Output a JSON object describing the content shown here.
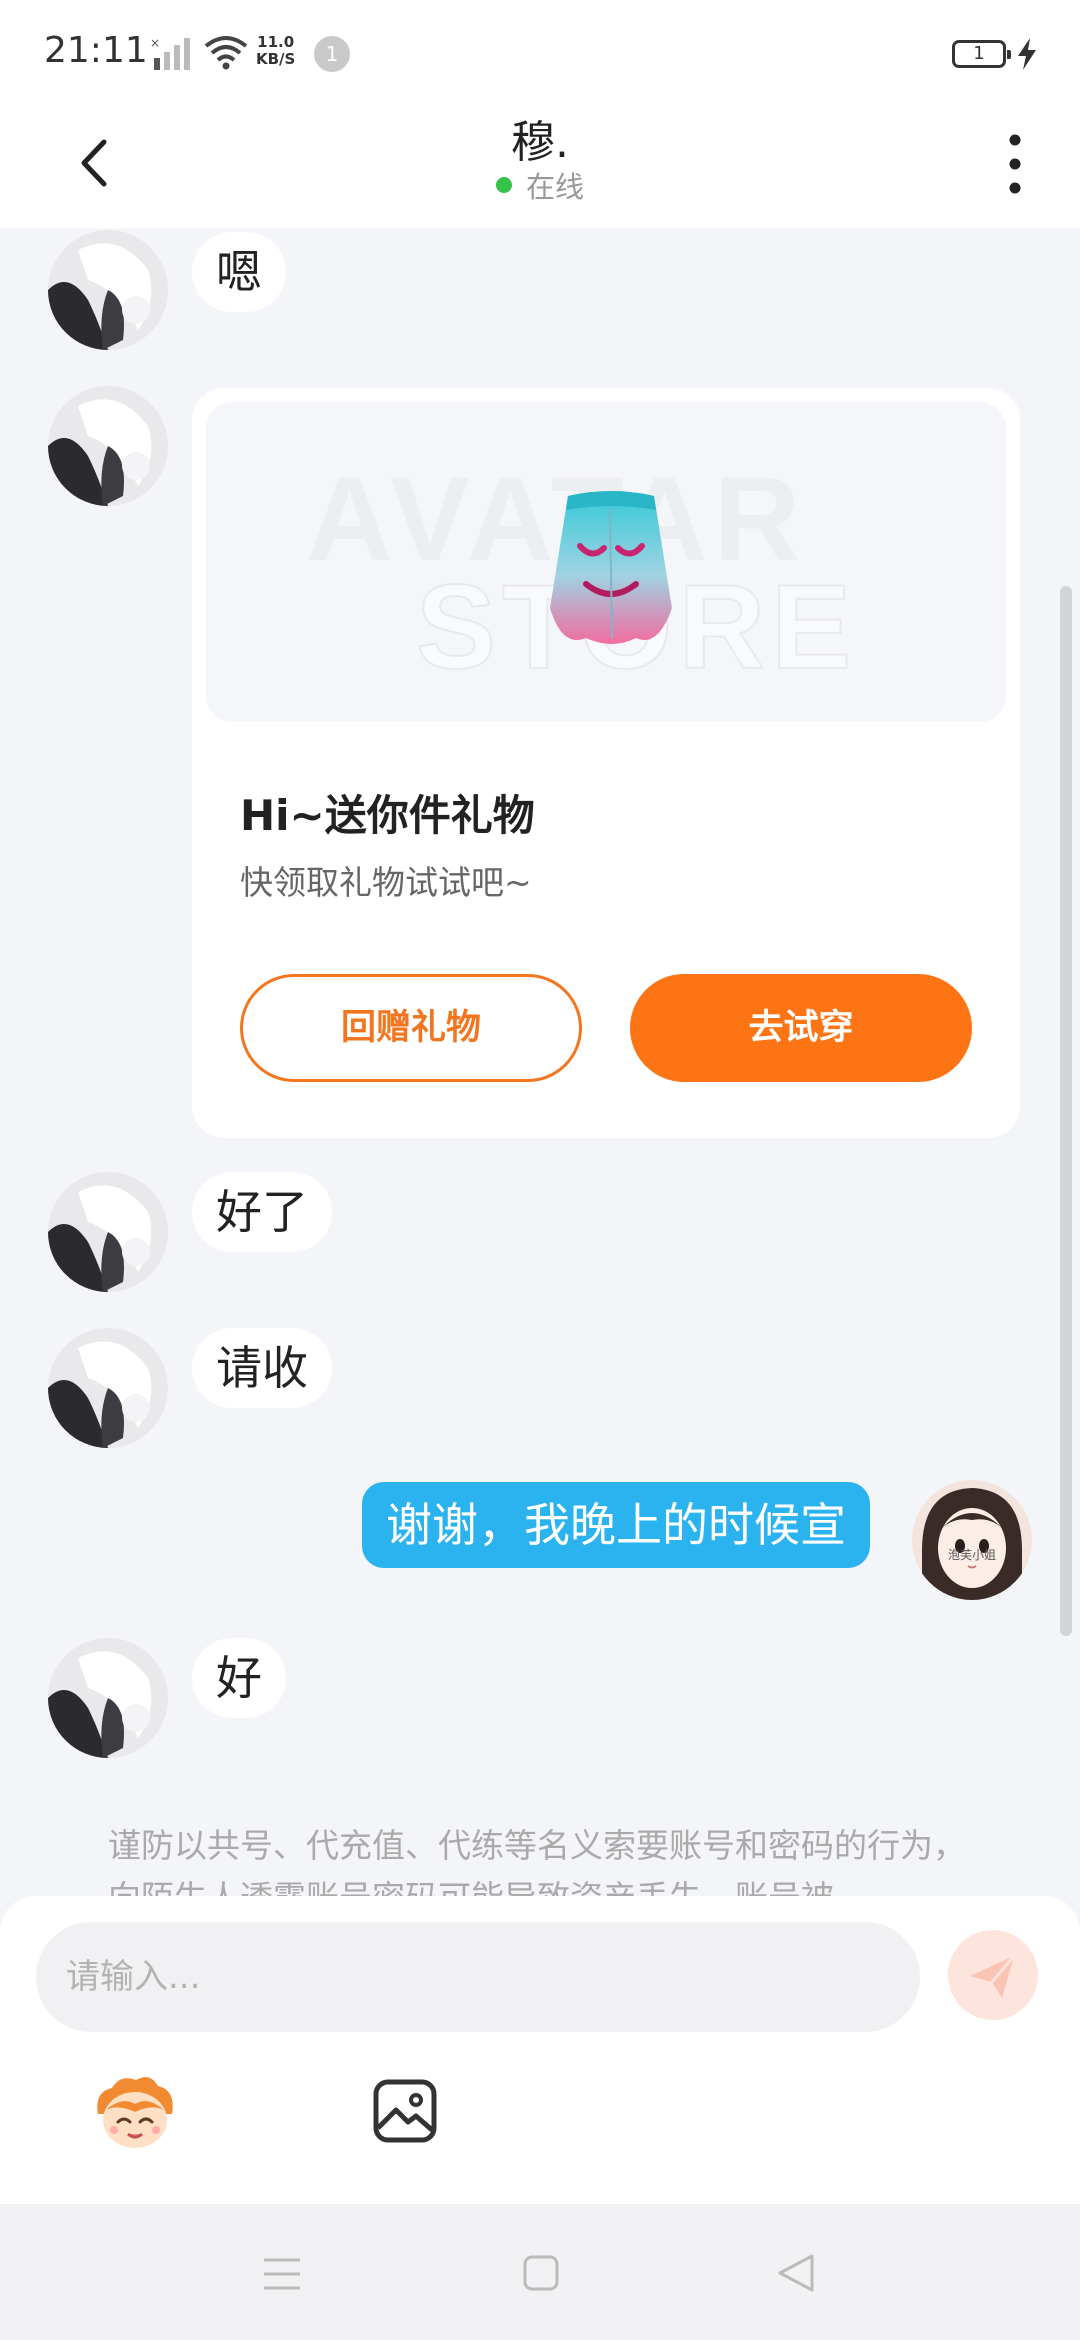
{
  "status_bar": {
    "time": "21:11",
    "net_speed_value": "11.0",
    "net_speed_unit": "KB/S",
    "notification_count": "1",
    "battery_level": "1"
  },
  "header": {
    "title": "穆.",
    "status": "在线",
    "online_color": "#36c34a"
  },
  "messages": [
    {
      "from": "other",
      "type": "text",
      "text": "嗯"
    },
    {
      "from": "other",
      "type": "gift",
      "watermark_line1": "AVATAR",
      "watermark_line2": "STORE",
      "title": "Hi~送你件礼物",
      "subtitle": "快领取礼物试试吧~",
      "return_button": "回赠礼物",
      "try_button": "去试穿"
    },
    {
      "from": "other",
      "type": "text",
      "text": "好了"
    },
    {
      "from": "other",
      "type": "text",
      "text": "请收"
    },
    {
      "from": "me",
      "type": "text",
      "text": "谢谢，我晚上的时候宣"
    },
    {
      "from": "other",
      "type": "text",
      "text": "好"
    }
  ],
  "my_avatar_caption": "泡芙小姐",
  "notice": "谨防以共号、代充值、代练等名义索要账号和密码的行为，向陌生人透露账号密码可能导致资产丢失，账号被",
  "input": {
    "placeholder": "请输入..."
  },
  "colors": {
    "accent_orange": "#fd7414",
    "my_bubble": "#2bb3f0"
  }
}
